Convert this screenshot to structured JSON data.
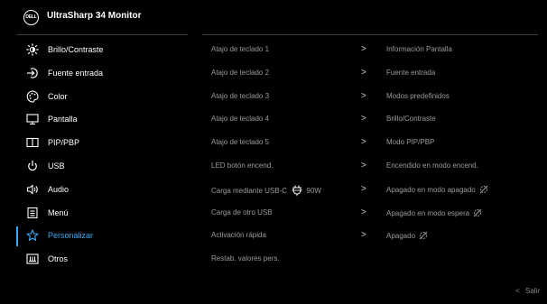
{
  "header": {
    "logo_text": "DELL",
    "title": "UltraSharp 34 Monitor"
  },
  "menu": {
    "items": [
      {
        "label": "Brillo/Contraste",
        "icon": "brightness-icon"
      },
      {
        "label": "Fuente entrada",
        "icon": "input-source-icon"
      },
      {
        "label": "Color",
        "icon": "palette-icon"
      },
      {
        "label": "Pantalla",
        "icon": "monitor-icon"
      },
      {
        "label": "PIP/PBP",
        "icon": "pip-pbp-icon"
      },
      {
        "label": "USB",
        "icon": "usb-icon"
      },
      {
        "label": "Audio",
        "icon": "speaker-icon"
      },
      {
        "label": "Menú",
        "icon": "menu-icon"
      },
      {
        "label": "Personalizar",
        "icon": "star-icon"
      },
      {
        "label": "Otros",
        "icon": "others-icon"
      }
    ],
    "active_index": 8,
    "active_color": "#39a9f4"
  },
  "submenu": {
    "rows": [
      {
        "label": "Atajo de teclado 1",
        "arrow": ">",
        "value": "Información Pantalla"
      },
      {
        "label": "Atajo de teclado 2",
        "arrow": ">",
        "value": "Fuente entrada"
      },
      {
        "label": "Atajo de teclado 3",
        "arrow": ">",
        "value": "Modos predefinidos"
      },
      {
        "label": "Atajo de teclado 4",
        "arrow": ">",
        "value": "Brillo/Contraste"
      },
      {
        "label": "Atajo de teclado 5",
        "arrow": ">",
        "value": "Modo PIP/PBP"
      },
      {
        "label": "LED botón encend.",
        "arrow": ">",
        "value": "Encendido en modo encend."
      },
      {
        "label": "Carga mediante USB-C",
        "label_suffix": "90W",
        "arrow": ">",
        "value": "Apagado en modo apagado"
      },
      {
        "label": "Carga de otro USB",
        "arrow": ">",
        "value": "Apagado en modo espera"
      },
      {
        "label": "Activación rápida",
        "arrow": ">",
        "value": "Apagado"
      },
      {
        "label": "Restab. valores pers.",
        "arrow": "",
        "value": ""
      }
    ]
  },
  "footer": {
    "exit_label": "Salir",
    "exit_chevron": "<"
  }
}
